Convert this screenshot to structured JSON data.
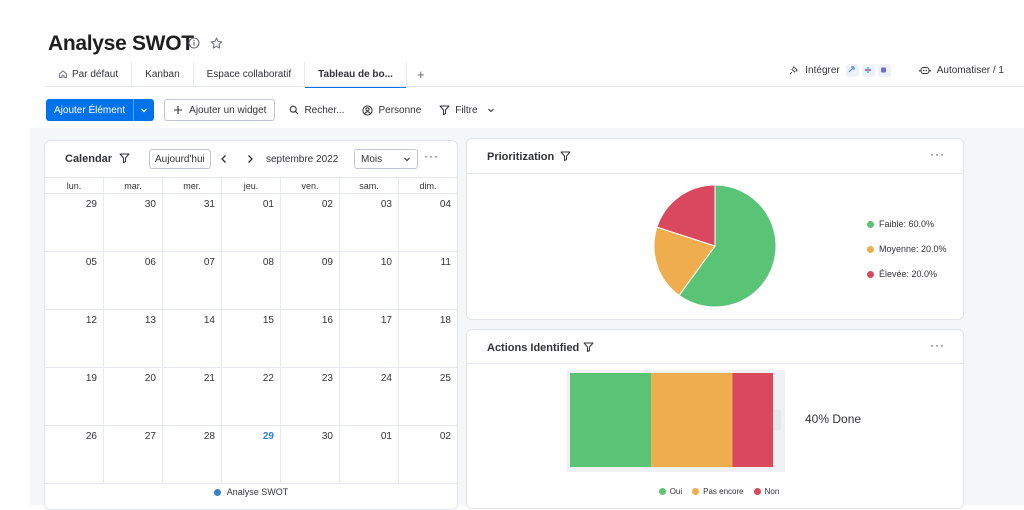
{
  "header": {
    "title": "Analyse SWOT",
    "tabs": [
      {
        "label": "Par défaut",
        "icon": "home-icon"
      },
      {
        "label": "Kanban"
      },
      {
        "label": "Espace collaboratif"
      },
      {
        "label": "Tableau de bo..."
      }
    ],
    "add_tab": "+",
    "integrate_label": "Intégrer",
    "automate_label": "Automatiser / 1"
  },
  "toolbar": {
    "add_item_label": "Ajouter Élément",
    "add_widget_label": "Ajouter un widget",
    "search_label": "Recher...",
    "person_label": "Personne",
    "filter_label": "Filtre"
  },
  "calendar": {
    "title": "Calendar",
    "today_label": "Aujourd'hui",
    "month_label": "septembre 2022",
    "view_label": "Mois",
    "days_of_week": [
      "lun.",
      "mar.",
      "mer.",
      "jeu.",
      "ven.",
      "sam.",
      "dim."
    ],
    "weeks": [
      [
        "29",
        "30",
        "31",
        "01",
        "02",
        "03",
        "04"
      ],
      [
        "05",
        "06",
        "07",
        "08",
        "09",
        "10",
        "11"
      ],
      [
        "12",
        "13",
        "14",
        "15",
        "16",
        "17",
        "18"
      ],
      [
        "19",
        "20",
        "21",
        "22",
        "23",
        "24",
        "25"
      ],
      [
        "26",
        "27",
        "28",
        "29",
        "30",
        "01",
        "02"
      ]
    ],
    "today": "29",
    "legend": "Analyse SWOT",
    "legend_color": "#3b82c4"
  },
  "prioritization": {
    "title": "Prioritization",
    "chart_data": {
      "type": "pie",
      "categories": [
        "Faible",
        "Moyenne",
        "Élevée"
      ],
      "values": [
        60.0,
        20.0,
        20.0
      ],
      "colors": [
        "#5ac476",
        "#f0ad4e",
        "#d9485d"
      ],
      "legend_labels": [
        "Faible: 60.0%",
        "Moyenne: 20.0%",
        "Élevée: 20.0%"
      ],
      "legend_position": "right"
    }
  },
  "actions": {
    "title": "Actions Identified",
    "done_label": "40% Done",
    "chart_data": {
      "type": "bar",
      "categories": [
        "Oui",
        "Pas encore",
        "Non"
      ],
      "values": [
        40,
        40,
        20
      ],
      "colors": [
        "#5ac476",
        "#f0ad4e",
        "#d9485d"
      ],
      "stacked": true,
      "legend_position": "bottom"
    }
  }
}
